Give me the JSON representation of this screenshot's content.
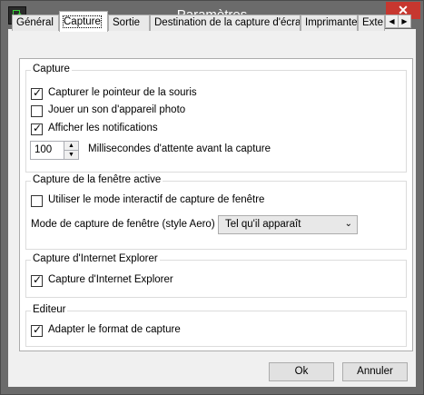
{
  "window": {
    "title": "Paramètres",
    "close_glyph": "✕"
  },
  "tabs": [
    {
      "label": "Général"
    },
    {
      "label": "Capture"
    },
    {
      "label": "Sortie"
    },
    {
      "label": "Destination de la capture d'écran"
    },
    {
      "label": "Imprimante"
    },
    {
      "label": "Exte"
    }
  ],
  "tab_scroll": {
    "left": "◀",
    "right": "▶"
  },
  "capture": {
    "legend": "Capture",
    "pointer": {
      "label": "Capturer le pointeur de la souris",
      "checked": true
    },
    "sound": {
      "label": "Jouer un son d'appareil photo",
      "checked": false
    },
    "notifications": {
      "label": "Afficher les notifications",
      "checked": true
    },
    "delay": {
      "value": "100",
      "label": "Millisecondes d'attente avant la capture"
    }
  },
  "active_window": {
    "legend": "Capture de la fenêtre active",
    "interactive": {
      "label": "Utiliser le mode interactif de capture de fenêtre",
      "checked": false
    },
    "mode_label": "Mode de capture de fenêtre (style Aero)",
    "mode_value": "Tel qu'il apparaît"
  },
  "ie": {
    "legend": "Capture d'Internet Explorer",
    "enable": {
      "label": "Capture d'Internet Explorer",
      "checked": true
    }
  },
  "editor": {
    "legend": "Editeur",
    "adapt": {
      "label": "Adapter le format de capture",
      "checked": true
    }
  },
  "buttons": {
    "ok": "Ok",
    "cancel": "Annuler"
  }
}
